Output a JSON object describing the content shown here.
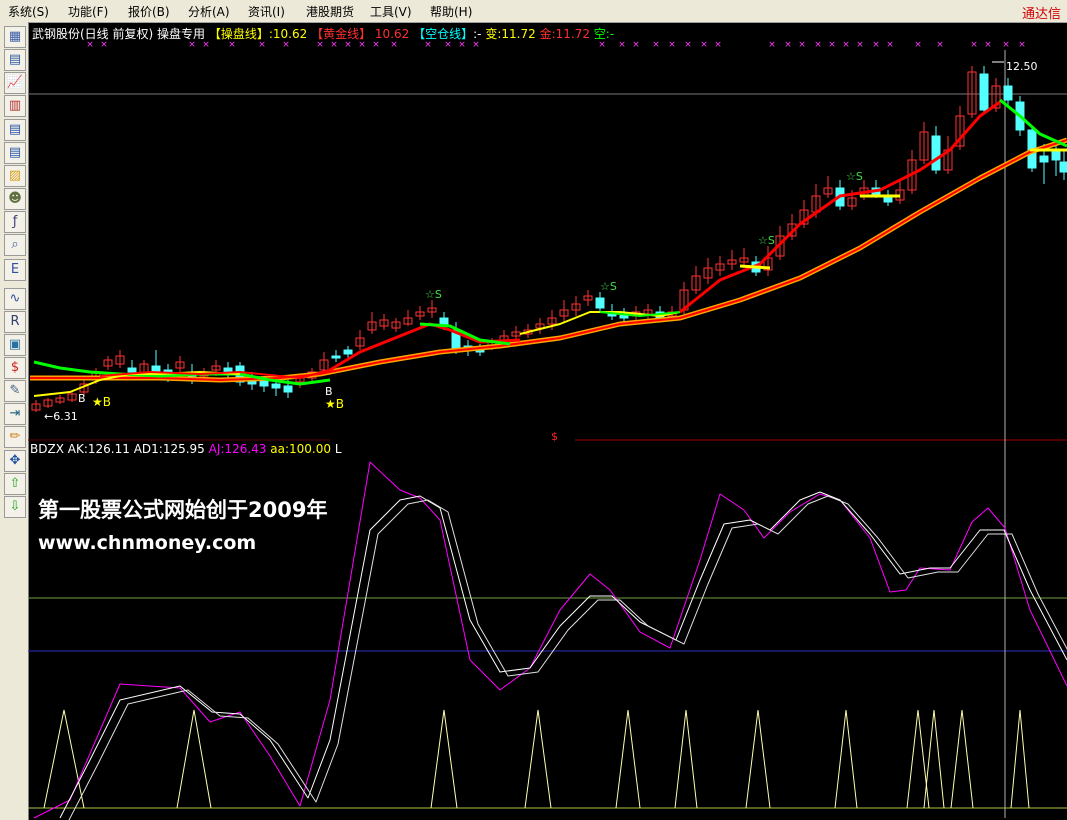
{
  "menu": {
    "items": [
      "系统(S)",
      "功能(F)",
      "报价(B)",
      "分析(A)",
      "资讯(I)",
      "港股期货",
      "工具(V)",
      "帮助(H)"
    ],
    "brand": "通达信"
  },
  "toolbar": {
    "icons": [
      "grid-icon",
      "line-chart-icon",
      "candle-icon",
      "bar-chart-icon",
      "table-icon",
      "list-icon",
      "folder-icon",
      "people-icon",
      "fx-icon",
      "search-icon",
      "etf-icon",
      "wave-icon",
      "rsi-icon",
      "monitor-icon",
      "dollar-icon",
      "wrench-icon",
      "export-icon",
      "pencil-icon",
      "move-icon",
      "up-arrow-icon",
      "down-arrow-icon"
    ]
  },
  "main_header": {
    "stock": "武钢股份(日线 前复权) 操盘专用",
    "tag1": "【操盘线】",
    "val1": ":10.62",
    "tag2": "【黄金线】",
    "val2": "10.62",
    "tag3": "【空仓线】",
    "val3": ":-",
    "bian": "变:11.72",
    "jin": "金:11.72",
    "kong": "空:-"
  },
  "price_annotations": {
    "high": "12.50",
    "low": "6.31",
    "buy_labels": [
      "B",
      "★B",
      "B",
      "★B"
    ],
    "sell_labels": [
      "☆S",
      "☆S",
      "☆S",
      "☆S"
    ],
    "s_marker": "$"
  },
  "sub_header": {
    "name": "BDZX",
    "ak": "AK:126.11",
    "ad1": "AD1:125.95",
    "aj": "AJ:126.43",
    "aa": "aa:100.00",
    "tail": "L"
  },
  "watermark": {
    "line1": "第一股票公式网始创于2009年",
    "line2": "www.chnmoney.com"
  },
  "colors": {
    "up": "#ff3232",
    "down": "#54ffff",
    "red_line": "#ff0000",
    "gold_line": "#ffa500",
    "green_line": "#00ff00",
    "yellow_line": "#ffff00",
    "magenta": "#ff00ff",
    "white": "#ffffff"
  }
}
